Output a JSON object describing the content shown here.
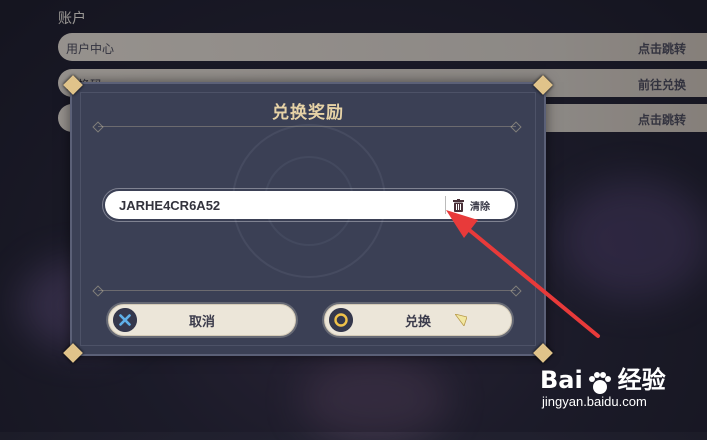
{
  "settings": {
    "section_title": "账户",
    "rows": [
      {
        "label": "用户中心",
        "action": "点击跳转"
      },
      {
        "label": "兑换码",
        "action": "前往兑换"
      },
      {
        "label": "",
        "action": "点击跳转"
      }
    ]
  },
  "dialog": {
    "title": "兑换奖励",
    "code_value": "JARHE4CR6A52",
    "clear_label": "清除",
    "cancel_label": "取消",
    "confirm_label": "兑换"
  },
  "watermark": {
    "brand": "Bai",
    "brand_suffix": "经验",
    "url": "jingyan.baidu.com"
  },
  "colors": {
    "dialog_bg": "#3b4055",
    "title_gold": "#e6d2a6",
    "button_bg": "#ece6d9",
    "annotation_arrow": "#e83a3a"
  }
}
